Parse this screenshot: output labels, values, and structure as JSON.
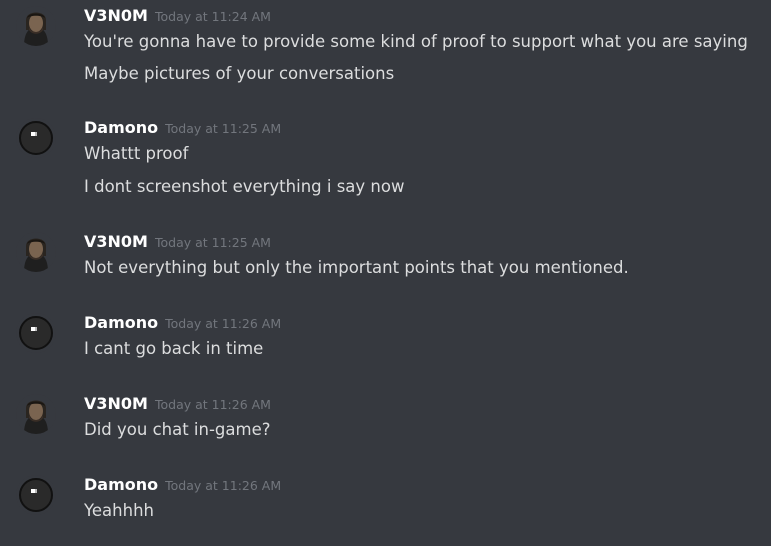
{
  "colors": {
    "background": "#36393f",
    "username": "#ffffff",
    "timestamp": "#72767d",
    "message_text": "#dcddde"
  },
  "messages": [
    {
      "author": "V3N0M",
      "avatar": "profile-photo",
      "time": "Today at 11:24 AM",
      "lines": [
        "You're gonna have to provide some kind of proof to support what you are saying",
        "Maybe pictures of your conversations"
      ]
    },
    {
      "author": "Damono",
      "avatar": "dark-circle-eye-icon",
      "time": "Today at 11:25 AM",
      "lines": [
        "Whattt proof",
        "I dont screenshot everything i say now"
      ]
    },
    {
      "author": "V3N0M",
      "avatar": "profile-photo",
      "time": "Today at 11:25 AM",
      "lines": [
        "Not everything but only the important points that you mentioned."
      ]
    },
    {
      "author": "Damono",
      "avatar": "dark-circle-eye-icon",
      "time": "Today at 11:26 AM",
      "lines": [
        "I cant go back in time"
      ]
    },
    {
      "author": "V3N0M",
      "avatar": "profile-photo",
      "time": "Today at 11:26 AM",
      "lines": [
        "Did you chat in-game?"
      ]
    },
    {
      "author": "Damono",
      "avatar": "dark-circle-eye-icon",
      "time": "Today at 11:26 AM",
      "lines": [
        "Yeahhhh"
      ]
    }
  ]
}
